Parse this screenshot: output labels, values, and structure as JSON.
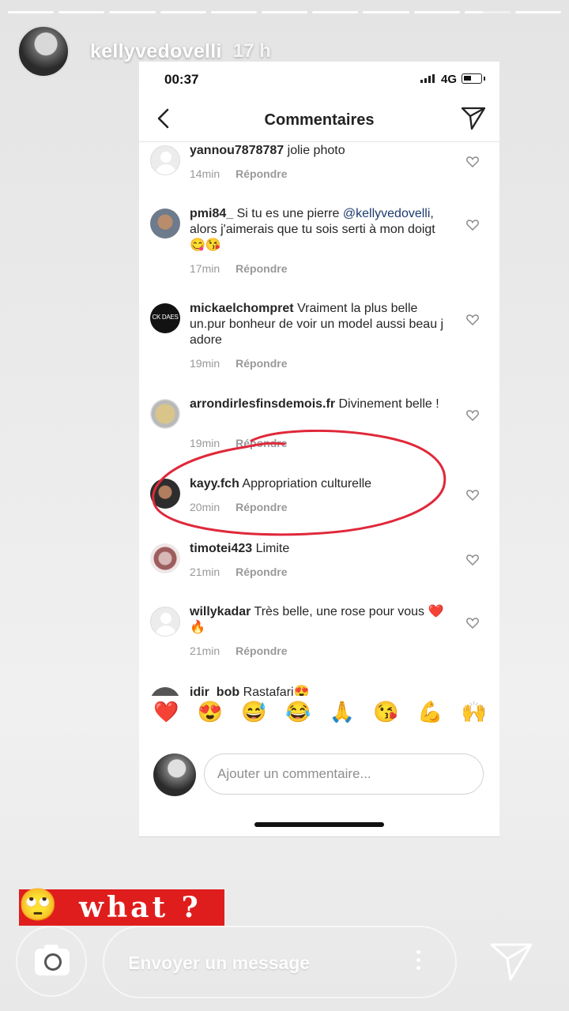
{
  "story": {
    "username": "kellyvedovelli",
    "time_ago": "17 h",
    "segments": 11,
    "active_segment": 10
  },
  "screenshot": {
    "status_bar": {
      "time": "00:37",
      "network": "4G"
    },
    "header": {
      "title": "Commentaires",
      "back_icon": "chevron-left-icon",
      "share_icon": "paper-plane-icon"
    },
    "comments": [
      {
        "username": "yannou7878787",
        "text": "jolie photo",
        "mention": "",
        "text_after": "",
        "time": "14min",
        "reply": "Répondre",
        "avatar": "blank"
      },
      {
        "username": "pmi84_",
        "text": "Si tu es une pierre",
        "mention": "@kellyvedovelli",
        "text_after": ", alors j'aimerais que tu sois serti à mon doigt 😋😘",
        "time": "17min",
        "reply": "Répondre",
        "avatar": "man"
      },
      {
        "username": "mickaelchompret",
        "text": "Vraiment la plus belle un.pur bonheur de voir un model aussi beau j adore",
        "mention": "",
        "text_after": "",
        "time": "19min",
        "reply": "Répondre",
        "avatar": "dark"
      },
      {
        "username": "arrondirlesfinsdemois.fr",
        "text": "Divinement belle !",
        "mention": "",
        "text_after": "",
        "time": "19min",
        "reply": "Répondre",
        "avatar": "coin"
      },
      {
        "username": "kayy.fch",
        "text": "Appropriation culturelle",
        "mention": "",
        "text_after": "",
        "time": "20min",
        "reply": "Répondre",
        "avatar": "kayy"
      },
      {
        "username": "timotei423",
        "text": "Limite",
        "mention": "",
        "text_after": "",
        "time": "21min",
        "reply": "Répondre",
        "avatar": "timo"
      },
      {
        "username": "willykadar",
        "text": "Très belle, une rose pour vous ❤️🔥",
        "mention": "",
        "text_after": "",
        "time": "21min",
        "reply": "Répondre",
        "avatar": "blank"
      },
      {
        "username": "idir_bob",
        "text": "Rastafari😍",
        "mention": "",
        "text_after": "",
        "time": "",
        "reply": "",
        "avatar": "idir"
      }
    ],
    "emoji_bar": [
      "❤️",
      "😍",
      "😅",
      "😂",
      "🙏",
      "😘",
      "💪",
      "🙌"
    ],
    "compose_placeholder": "Ajouter un commentaire...",
    "annotation_color": "#e0283a"
  },
  "sticker": {
    "emoji": "🙄",
    "text": "what ?",
    "background": "#e01d1d"
  },
  "reply_bar": {
    "placeholder": "Envoyer un message"
  }
}
